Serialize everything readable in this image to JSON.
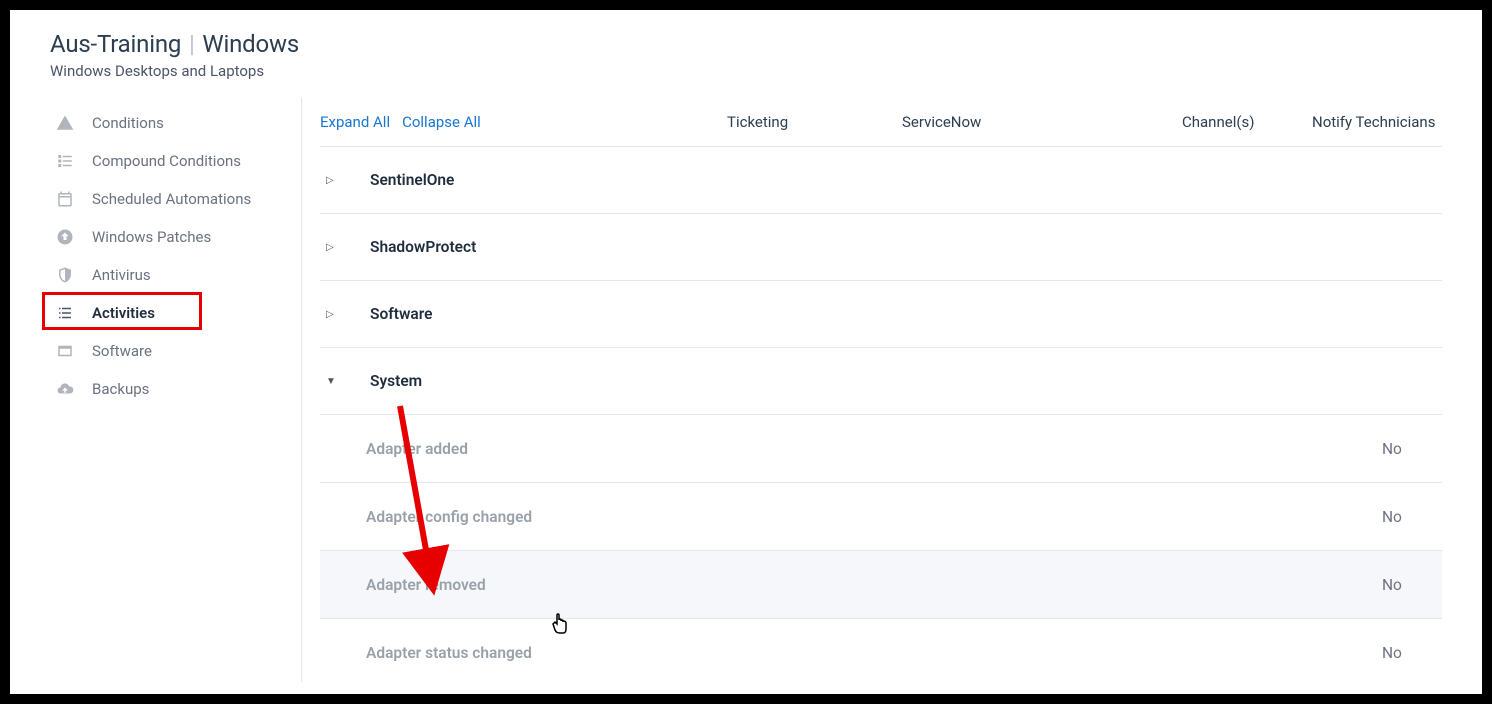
{
  "header": {
    "title_left": "Aus-Training",
    "title_right": "Windows",
    "subtitle": "Windows Desktops and Laptops"
  },
  "sidebar": {
    "items": [
      {
        "label": "Conditions",
        "icon": "warning-triangle-icon",
        "active": false
      },
      {
        "label": "Compound Conditions",
        "icon": "compound-list-icon",
        "active": false
      },
      {
        "label": "Scheduled Automations",
        "icon": "calendar-icon",
        "active": false
      },
      {
        "label": "Windows Patches",
        "icon": "patch-up-icon",
        "active": false
      },
      {
        "label": "Antivirus",
        "icon": "shield-icon",
        "active": false
      },
      {
        "label": "Activities",
        "icon": "activities-list-icon",
        "active": true,
        "highlighted": true
      },
      {
        "label": "Software",
        "icon": "window-icon",
        "active": false
      },
      {
        "label": "Backups",
        "icon": "cloud-up-icon",
        "active": false
      }
    ]
  },
  "toolbar": {
    "expand_all": "Expand All",
    "collapse_all": "Collapse All"
  },
  "columns": {
    "ticketing": "Ticketing",
    "servicenow": "ServiceNow",
    "channels": "Channel(s)",
    "notify": "Notify Technicians"
  },
  "sections": [
    {
      "name": "SentinelOne",
      "expanded": false
    },
    {
      "name": "ShadowProtect",
      "expanded": false
    },
    {
      "name": "Software",
      "expanded": false
    },
    {
      "name": "System",
      "expanded": true,
      "activities": [
        {
          "name": "Adapter added",
          "notify": "No"
        },
        {
          "name": "Adapter config changed",
          "notify": "No"
        },
        {
          "name": "Adapter removed",
          "notify": "No",
          "hovered": true
        },
        {
          "name": "Adapter status changed",
          "notify": "No"
        }
      ]
    }
  ]
}
